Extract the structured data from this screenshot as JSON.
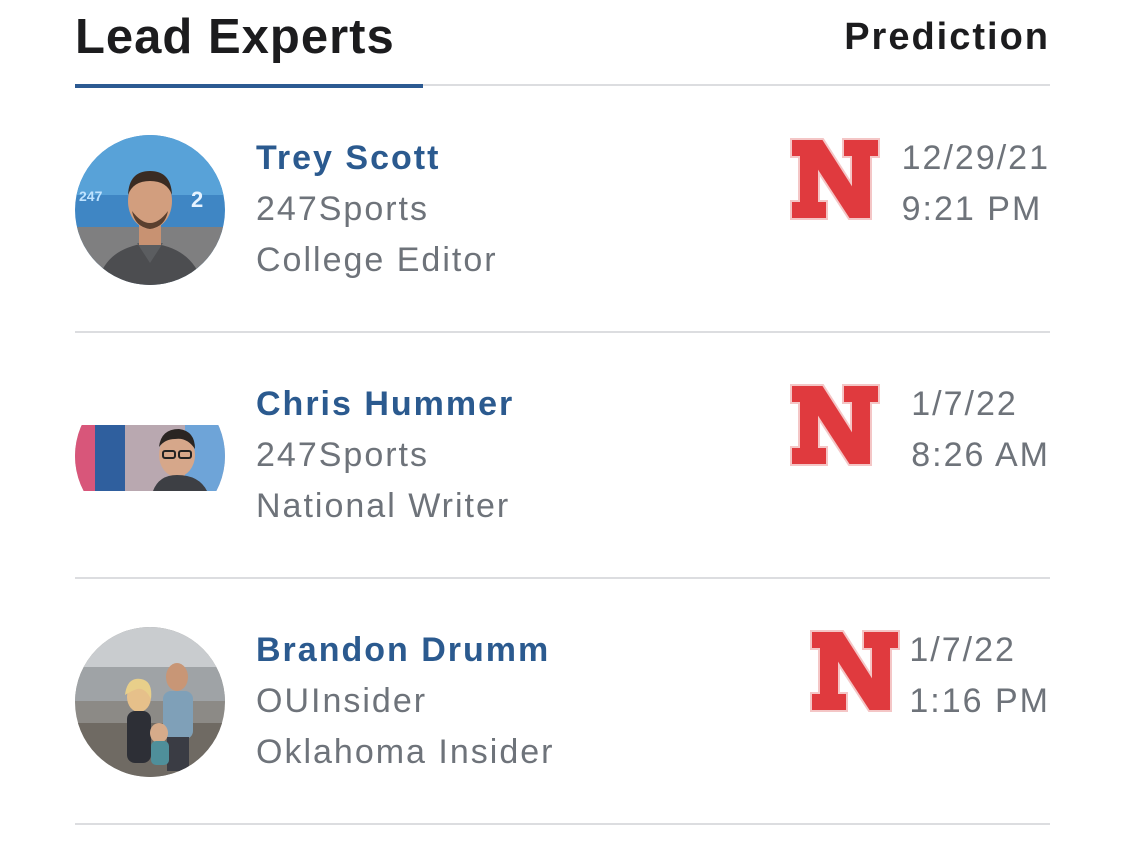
{
  "header": {
    "title": "Lead Experts",
    "prediction_label": "Prediction"
  },
  "colors": {
    "accent": "#2c5a92",
    "name": "#2b5a8f",
    "meta_text": "#6e737a",
    "nebraska_red": "#e03a3e"
  },
  "experts": [
    {
      "name": "Trey Scott",
      "outlet": "247Sports",
      "role": "College Editor",
      "team_logo": "nebraska-n-logo",
      "date": "12/29/21",
      "time": "9:21 PM"
    },
    {
      "name": "Chris Hummer",
      "outlet": "247Sports",
      "role": "National Writer",
      "team_logo": "nebraska-n-logo",
      "date": "1/7/22",
      "time": "8:26 AM"
    },
    {
      "name": "Brandon Drumm",
      "outlet": "OUInsider",
      "role": "Oklahoma Insider",
      "team_logo": "nebraska-n-logo",
      "date": "1/7/22",
      "time": "1:16 PM"
    }
  ]
}
